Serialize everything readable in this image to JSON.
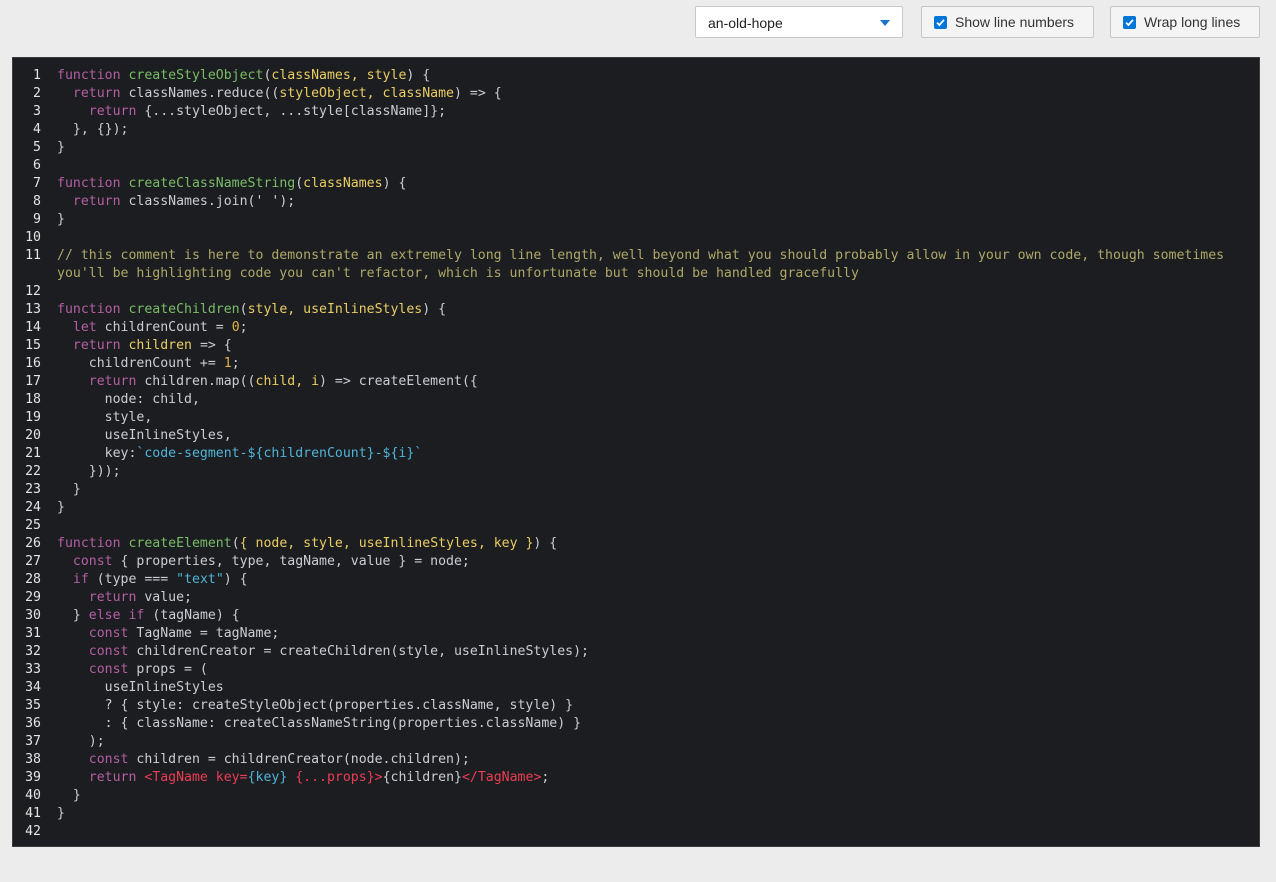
{
  "toolbar": {
    "theme_value": "an-old-hope",
    "show_line_numbers_label": "Show line numbers",
    "wrap_long_lines_label": "Wrap long lines"
  },
  "code": {
    "lines": [
      [
        [
          "k",
          "function "
        ],
        [
          "f",
          "createStyleObject"
        ],
        [
          "",
          "("
        ],
        [
          "p",
          "classNames, style"
        ],
        [
          "",
          ") {"
        ]
      ],
      [
        [
          "",
          "  "
        ],
        [
          "k",
          "return "
        ],
        [
          "",
          "classNames.reduce(("
        ],
        [
          "p",
          "styleObject, className"
        ],
        [
          "",
          ") => {"
        ]
      ],
      [
        [
          "",
          "    "
        ],
        [
          "k",
          "return "
        ],
        [
          "",
          "{...styleObject, ...style[className]};"
        ]
      ],
      [
        [
          "",
          "  }, {});"
        ]
      ],
      [
        [
          "",
          "}"
        ]
      ],
      [],
      [
        [
          "k",
          "function "
        ],
        [
          "f",
          "createClassNameString"
        ],
        [
          "",
          "("
        ],
        [
          "p",
          "classNames"
        ],
        [
          "",
          ") {"
        ]
      ],
      [
        [
          "",
          "  "
        ],
        [
          "k",
          "return "
        ],
        [
          "",
          "classNames.join(' ');"
        ]
      ],
      [
        [
          "",
          "}"
        ]
      ],
      [],
      [
        [
          "c",
          "// this comment is here to demonstrate an extremely long line length, well beyond what you should probably allow in your own code, though sometimes you'll be highlighting code you can't refactor, which is unfortunate but should be handled gracefully"
        ]
      ],
      [],
      [
        [
          "k",
          "function "
        ],
        [
          "f",
          "createChildren"
        ],
        [
          "",
          "("
        ],
        [
          "p",
          "style, useInlineStyles"
        ],
        [
          "",
          ") {"
        ]
      ],
      [
        [
          "",
          "  "
        ],
        [
          "k",
          "let "
        ],
        [
          "",
          "childrenCount = "
        ],
        [
          "n",
          "0"
        ],
        [
          "",
          ";"
        ]
      ],
      [
        [
          "",
          "  "
        ],
        [
          "k",
          "return "
        ],
        [
          "p",
          "children"
        ],
        [
          "",
          " => {"
        ]
      ],
      [
        [
          "",
          "    childrenCount += "
        ],
        [
          "n",
          "1"
        ],
        [
          "",
          ";"
        ]
      ],
      [
        [
          "",
          "    "
        ],
        [
          "k",
          "return "
        ],
        [
          "",
          "children.map(("
        ],
        [
          "p",
          "child, i"
        ],
        [
          "",
          ") => createElement({"
        ]
      ],
      [
        [
          "",
          "      node: child,"
        ]
      ],
      [
        [
          "",
          "      style,"
        ]
      ],
      [
        [
          "",
          "      useInlineStyles,"
        ]
      ],
      [
        [
          "",
          "      key:"
        ],
        [
          "s",
          "`code-segment-${childrenCount}-${i}`"
        ]
      ],
      [
        [
          "",
          "    }));"
        ]
      ],
      [
        [
          "",
          "  }"
        ]
      ],
      [
        [
          "",
          "}"
        ]
      ],
      [],
      [
        [
          "k",
          "function "
        ],
        [
          "f",
          "createElement"
        ],
        [
          "",
          "("
        ],
        [
          "p",
          "{ node, style, useInlineStyles, key }"
        ],
        [
          "",
          ") {"
        ]
      ],
      [
        [
          "",
          "  "
        ],
        [
          "k",
          "const "
        ],
        [
          "",
          "{ properties, type, tagName, value } = node;"
        ]
      ],
      [
        [
          "",
          "  "
        ],
        [
          "k",
          "if "
        ],
        [
          "",
          "(type === "
        ],
        [
          "s",
          "\"text\""
        ],
        [
          "",
          ") {"
        ]
      ],
      [
        [
          "",
          "    "
        ],
        [
          "k",
          "return "
        ],
        [
          "",
          "value;"
        ]
      ],
      [
        [
          "",
          "  } "
        ],
        [
          "k",
          "else if "
        ],
        [
          "",
          "(tagName) {"
        ]
      ],
      [
        [
          "",
          "    "
        ],
        [
          "k",
          "const "
        ],
        [
          "",
          "TagName = tagName;"
        ]
      ],
      [
        [
          "",
          "    "
        ],
        [
          "k",
          "const "
        ],
        [
          "",
          "childrenCreator = createChildren(style, useInlineStyles);"
        ]
      ],
      [
        [
          "",
          "    "
        ],
        [
          "k",
          "const "
        ],
        [
          "",
          "props = ("
        ]
      ],
      [
        [
          "",
          "      useInlineStyles"
        ]
      ],
      [
        [
          "",
          "      ? { style: createStyleObject(properties.className, style) }"
        ]
      ],
      [
        [
          "",
          "      : { className: createClassNameString(properties.className) }"
        ]
      ],
      [
        [
          "",
          "    );"
        ]
      ],
      [
        [
          "",
          "    "
        ],
        [
          "k",
          "const "
        ],
        [
          "",
          "children = childrenCreator(node.children);"
        ]
      ],
      [
        [
          "",
          "    "
        ],
        [
          "k",
          "return "
        ],
        [
          "t",
          "<TagName key="
        ],
        [
          "s",
          "{key}"
        ],
        [
          "",
          " "
        ],
        [
          "t",
          "{...props}"
        ],
        [
          "t",
          ">"
        ],
        [
          "",
          "{children}"
        ],
        [
          "t",
          "</TagName>"
        ],
        [
          "",
          ";"
        ]
      ],
      [
        [
          "",
          "  }"
        ]
      ],
      [
        [
          "",
          "}"
        ]
      ],
      []
    ]
  }
}
